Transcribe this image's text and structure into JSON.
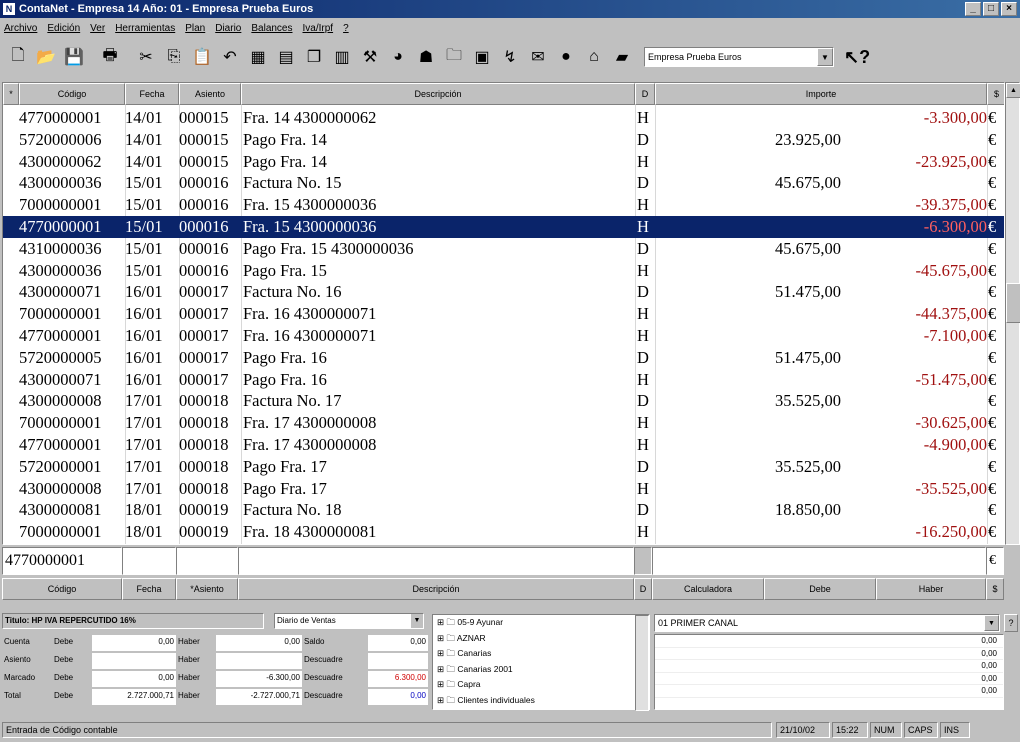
{
  "window": {
    "title": "ContaNet - Empresa 14  Año: 01 - Empresa Prueba Euros",
    "app_icon": "N"
  },
  "menu": [
    "Archivo",
    "Edición",
    "Ver",
    "Herramientas",
    "Plan",
    "Diario",
    "Balances",
    "Iva/Irpf",
    "?"
  ],
  "toolbar": {
    "icons": [
      "new-icon",
      "open-icon",
      "save-icon",
      "print-icon",
      "cut-icon",
      "copy-icon",
      "paste-icon",
      "undo-icon",
      "grid-icon",
      "calculator-icon",
      "docs-icon",
      "chart-icon",
      "tool-icon",
      "globe-icon",
      "people-icon",
      "folder-icon",
      "monitor-icon",
      "graph-icon",
      "mail-icon",
      "money-icon",
      "bank-icon",
      "cash-icon"
    ],
    "company": "Empresa Prueba Euros",
    "help": "?"
  },
  "grid": {
    "headers": {
      "marker": "*",
      "codigo": "Código",
      "fecha": "Fecha",
      "asiento": "Asiento",
      "descripcion": "Descripción",
      "dh": "D",
      "importe": "Importe",
      "cur": "$"
    },
    "rows": [
      {
        "code": "4770000001",
        "date": "14/01",
        "asiento": "000015",
        "desc": "Fra. 14 4300000062",
        "dh": "H",
        "debe": "",
        "haber": "-3.300,00",
        "cur": "€"
      },
      {
        "code": "5720000006",
        "date": "14/01",
        "asiento": "000015",
        "desc": "Pago Fra. 14",
        "dh": "D",
        "debe": "23.925,00",
        "haber": "",
        "cur": "€"
      },
      {
        "code": "4300000062",
        "date": "14/01",
        "asiento": "000015",
        "desc": "Pago Fra. 14",
        "dh": "H",
        "debe": "",
        "haber": "-23.925,00",
        "cur": "€"
      },
      {
        "code": "4300000036",
        "date": "15/01",
        "asiento": "000016",
        "desc": "Factura No.  15",
        "dh": "D",
        "debe": "45.675,00",
        "haber": "",
        "cur": "€"
      },
      {
        "code": "7000000001",
        "date": "15/01",
        "asiento": "000016",
        "desc": "Fra. 15 4300000036",
        "dh": "H",
        "debe": "",
        "haber": "-39.375,00",
        "cur": "€"
      },
      {
        "code": "4770000001",
        "date": "15/01",
        "asiento": "000016",
        "desc": "Fra. 15 4300000036",
        "dh": "H",
        "debe": "",
        "haber": "-6.300,00",
        "cur": "€",
        "selected": true
      },
      {
        "code": "4310000036",
        "date": "15/01",
        "asiento": "000016",
        "desc": "Pago Fra. 15 4300000036",
        "dh": "D",
        "debe": "45.675,00",
        "haber": "",
        "cur": "€"
      },
      {
        "code": "4300000036",
        "date": "15/01",
        "asiento": "000016",
        "desc": "Pago Fra. 15",
        "dh": "H",
        "debe": "",
        "haber": "-45.675,00",
        "cur": "€"
      },
      {
        "code": "4300000071",
        "date": "16/01",
        "asiento": "000017",
        "desc": "Factura No.  16",
        "dh": "D",
        "debe": "51.475,00",
        "haber": "",
        "cur": "€"
      },
      {
        "code": "7000000001",
        "date": "16/01",
        "asiento": "000017",
        "desc": "Fra. 16 4300000071",
        "dh": "H",
        "debe": "",
        "haber": "-44.375,00",
        "cur": "€"
      },
      {
        "code": "4770000001",
        "date": "16/01",
        "asiento": "000017",
        "desc": "Fra. 16 4300000071",
        "dh": "H",
        "debe": "",
        "haber": "-7.100,00",
        "cur": "€"
      },
      {
        "code": "5720000005",
        "date": "16/01",
        "asiento": "000017",
        "desc": "Pago Fra. 16",
        "dh": "D",
        "debe": "51.475,00",
        "haber": "",
        "cur": "€"
      },
      {
        "code": "4300000071",
        "date": "16/01",
        "asiento": "000017",
        "desc": "Pago Fra. 16",
        "dh": "H",
        "debe": "",
        "haber": "-51.475,00",
        "cur": "€"
      },
      {
        "code": "4300000008",
        "date": "17/01",
        "asiento": "000018",
        "desc": "Factura No.  17",
        "dh": "D",
        "debe": "35.525,00",
        "haber": "",
        "cur": "€"
      },
      {
        "code": "7000000001",
        "date": "17/01",
        "asiento": "000018",
        "desc": "Fra. 17 4300000008",
        "dh": "H",
        "debe": "",
        "haber": "-30.625,00",
        "cur": "€"
      },
      {
        "code": "4770000001",
        "date": "17/01",
        "asiento": "000018",
        "desc": "Fra. 17 4300000008",
        "dh": "H",
        "debe": "",
        "haber": "-4.900,00",
        "cur": "€"
      },
      {
        "code": "5720000001",
        "date": "17/01",
        "asiento": "000018",
        "desc": "Pago Fra. 17",
        "dh": "D",
        "debe": "35.525,00",
        "haber": "",
        "cur": "€"
      },
      {
        "code": "4300000008",
        "date": "17/01",
        "asiento": "000018",
        "desc": "Pago Fra. 17",
        "dh": "H",
        "debe": "",
        "haber": "-35.525,00",
        "cur": "€"
      },
      {
        "code": "4300000081",
        "date": "18/01",
        "asiento": "000019",
        "desc": "Factura No.  18",
        "dh": "D",
        "debe": "18.850,00",
        "haber": "",
        "cur": "€"
      },
      {
        "code": "7000000001",
        "date": "18/01",
        "asiento": "000019",
        "desc": "Fra. 18 4300000081",
        "dh": "H",
        "debe": "",
        "haber": "-16.250,00",
        "cur": "€"
      }
    ]
  },
  "entry": {
    "code": "4770000001",
    "cur": "€"
  },
  "footer_headers": {
    "codigo": "Código",
    "fecha": "Fecha",
    "asiento": "*Asiento",
    "descripcion": "Descripción",
    "dh": "D",
    "calculadora": "Calculadora",
    "debe": "Debe",
    "haber": "Haber",
    "cur": "$"
  },
  "info": {
    "account_title": "Titulo: HP IVA REPERCUTIDO 16%",
    "journal": "Diario de Ventas",
    "labels": {
      "cuenta": "Cuenta",
      "asiento": "Asiento",
      "marcado": "Marcado",
      "total": "Total",
      "debe": "Debe",
      "haber": "Haber",
      "saldo": "Saldo",
      "descuadre": "Descuadre"
    },
    "cuenta_debe": "0,00",
    "cuenta_haber": "0,00",
    "cuenta_saldo": "0,00",
    "marcado_debe": "0,00",
    "marcado_haber": "-6.300,00",
    "marcado_descuadre": "6.300,00",
    "total_debe": "2.727.000,71",
    "total_haber": "-2.727.000,71",
    "total_descuadre": "0,00"
  },
  "tree": [
    "05-9 Ayunar",
    "AZNAR",
    "Canarias",
    "Canarias 2001",
    "Capra",
    "Clientes individuales"
  ],
  "channel": {
    "selected": "01 PRIMER CANAL",
    "help": "?",
    "values": [
      "0,00",
      "0,00",
      "0,00",
      "0,00",
      "0,00"
    ]
  },
  "status": {
    "message": "Entrada de Código contable",
    "date": "21/10/02",
    "time": "15:22",
    "num": "NUM",
    "caps": "CAPS",
    "ins": "INS"
  },
  "colors": {
    "titlebar": "#0a246a",
    "selection": "#0a246a",
    "negative": "#a01010",
    "face": "#c0c0c0"
  }
}
